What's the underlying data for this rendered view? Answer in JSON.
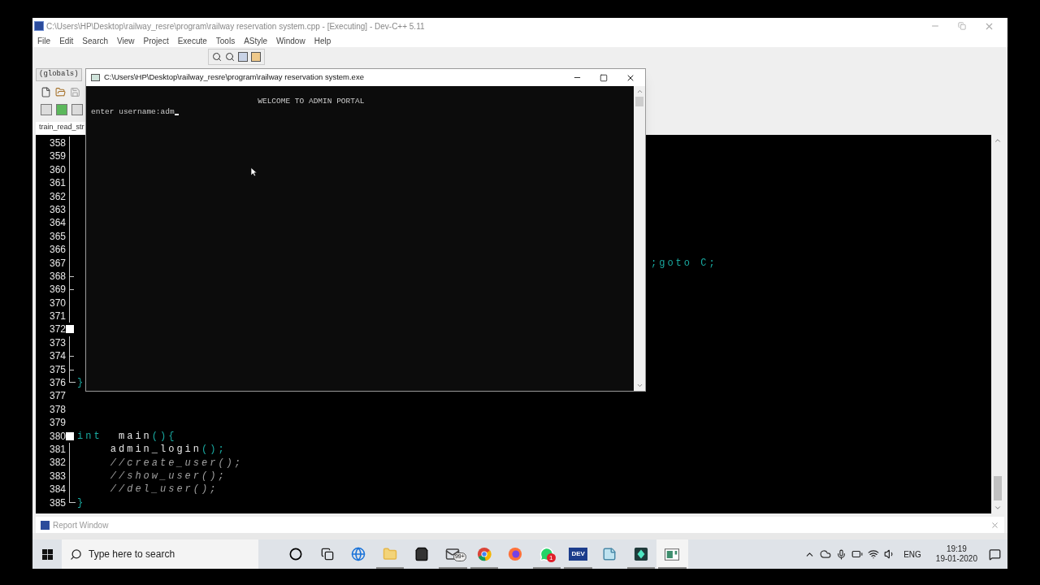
{
  "ide_window": {
    "title": "C:\\Users\\HP\\Desktop\\railway_resre\\program\\railway reservation system.cpp - [Executing] - Dev-C++ 5.11",
    "menu": [
      "File",
      "Edit",
      "Search",
      "View",
      "Project",
      "Execute",
      "Tools",
      "AStyle",
      "Window",
      "Help"
    ],
    "scope": "(globals)",
    "file_tab": "train_read_str",
    "lines": [
      {
        "number": "358",
        "kind": "line"
      },
      {
        "number": "359",
        "kind": "line"
      },
      {
        "number": "360",
        "kind": "line"
      },
      {
        "number": "361",
        "kind": "line"
      },
      {
        "number": "362",
        "kind": "line"
      },
      {
        "number": "363",
        "kind": "line"
      },
      {
        "number": "364",
        "kind": "line"
      },
      {
        "number": "365",
        "kind": "line"
      },
      {
        "number": "366",
        "kind": "line"
      },
      {
        "number": "367",
        "kind": "line",
        "code": [
          {
            "kind": "tail",
            "text": ";goto C;"
          }
        ]
      },
      {
        "number": "368",
        "kind": "branch"
      },
      {
        "number": "369",
        "kind": "branch"
      },
      {
        "number": "370",
        "kind": "line"
      },
      {
        "number": "371",
        "kind": "line"
      },
      {
        "number": "372",
        "kind": "box"
      },
      {
        "number": "373",
        "kind": "line"
      },
      {
        "number": "374",
        "kind": "branch"
      },
      {
        "number": "375",
        "kind": "branch"
      },
      {
        "number": "376",
        "kind": "end",
        "code": [
          {
            "kind": "punct",
            "text": "}"
          }
        ]
      },
      {
        "number": "377",
        "kind": "none"
      },
      {
        "number": "378",
        "kind": "none"
      },
      {
        "number": "379",
        "kind": "none"
      },
      {
        "number": "380",
        "kind": "box",
        "code": [
          {
            "kind": "keyword",
            "text": "int"
          },
          {
            "kind": "plain",
            "text": "  main"
          },
          {
            "kind": "punct",
            "text": "(){"
          }
        ]
      },
      {
        "number": "381",
        "kind": "line",
        "code": [
          {
            "kind": "plain",
            "text": "    admin_login"
          },
          {
            "kind": "punct",
            "text": "();"
          }
        ]
      },
      {
        "number": "382",
        "kind": "line",
        "code": [
          {
            "kind": "comment",
            "text": "    //create_user();"
          }
        ]
      },
      {
        "number": "383",
        "kind": "line",
        "code": [
          {
            "kind": "comment",
            "text": "    //show_user();"
          }
        ]
      },
      {
        "number": "384",
        "kind": "line",
        "code": [
          {
            "kind": "comment",
            "text": "    //del_user();"
          }
        ]
      },
      {
        "number": "385",
        "kind": "end",
        "code": [
          {
            "kind": "punct",
            "text": "}"
          }
        ]
      }
    ],
    "report_window": {
      "title": "Report Window"
    }
  },
  "console_window": {
    "title": "C:\\Users\\HP\\Desktop\\railway_resre\\program\\railway reservation system.exe",
    "lines": [
      {
        "text": "                                    WELCOME TO ADMIN PORTAL",
        "cursor": false
      },
      {
        "text": "enter username:adm",
        "cursor": true
      }
    ]
  },
  "taskbar": {
    "search_placeholder": "Type here to search",
    "apps": [
      {
        "kind": "cortana",
        "running": false,
        "selected": false
      },
      {
        "kind": "taskview",
        "running": false,
        "selected": false
      },
      {
        "kind": "edge",
        "running": false,
        "selected": false
      },
      {
        "kind": "explorer",
        "running": true,
        "selected": false
      },
      {
        "kind": "store",
        "running": false,
        "selected": false
      },
      {
        "kind": "mail",
        "running": true,
        "selected": false,
        "badge": "99+"
      },
      {
        "kind": "chrome",
        "running": true,
        "selected": false
      },
      {
        "kind": "firefox",
        "running": false,
        "selected": false
      },
      {
        "kind": "whatsapp",
        "running": true,
        "selected": false,
        "badge": "1"
      },
      {
        "kind": "devcpp",
        "running": true,
        "selected": false,
        "label": "DEV"
      },
      {
        "kind": "notepad",
        "running": false,
        "selected": false
      },
      {
        "kind": "filmora",
        "running": true,
        "selected": false
      },
      {
        "kind": "console",
        "running": true,
        "selected": true
      }
    ],
    "language": "ENG",
    "time": "19:19",
    "date": "19-01-2020"
  }
}
